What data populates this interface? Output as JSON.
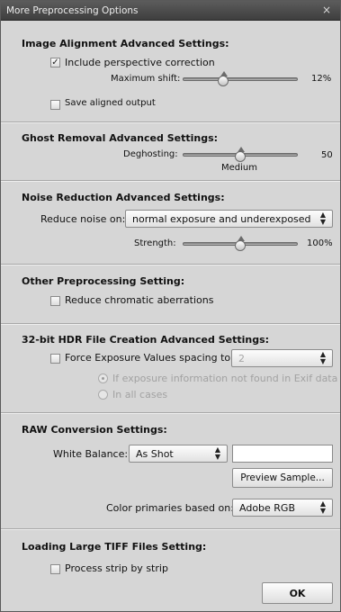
{
  "window": {
    "title": "More Preprocessing Options",
    "close_glyph": "×"
  },
  "alignment": {
    "title": "Image Alignment Advanced Settings:",
    "perspective_label": "Include perspective correction",
    "perspective_checked": true,
    "max_shift_label": "Maximum shift:",
    "max_shift_value": "12%",
    "max_shift_level": 0.35,
    "save_label": "Save aligned output",
    "save_checked": false
  },
  "ghost": {
    "title": "Ghost Removal Advanced Settings:",
    "deghosting_label": "Deghosting:",
    "deghosting_value": "50",
    "deghosting_level": 0.5,
    "deghosting_caption": "Medium"
  },
  "noise": {
    "title": "Noise Reduction Advanced Settings:",
    "reduce_label": "Reduce noise on:",
    "reduce_value": "normal exposure and underexposed",
    "strength_label": "Strength:",
    "strength_value": "100%",
    "strength_level": 0.5
  },
  "other": {
    "title": "Other Preprocessing Setting:",
    "chromatic_label": "Reduce chromatic aberrations",
    "chromatic_checked": false
  },
  "hdr": {
    "title": "32-bit HDR File Creation Advanced Settings:",
    "force_label": "Force Exposure Values spacing to:",
    "force_checked": false,
    "spacing_value": "2",
    "radio_exif_label": "If exposure information not found in Exif data",
    "radio_all_label": "In all cases"
  },
  "raw": {
    "title": "RAW Conversion Settings:",
    "wb_label": "White Balance:",
    "wb_value": "As Shot",
    "wb_text": "",
    "preview_label": "Preview Sample...",
    "primaries_label": "Color primaries based on:",
    "primaries_value": "Adobe RGB"
  },
  "tiff": {
    "title": "Loading Large TIFF Files Setting:",
    "strip_label": "Process strip by strip",
    "strip_checked": false
  },
  "footer": {
    "ok_label": "OK"
  },
  "icons": {
    "checkmark": "checkmark-icon",
    "select_arrows": "updown-arrows-icon",
    "slider_thumb": "slider-thumb"
  }
}
